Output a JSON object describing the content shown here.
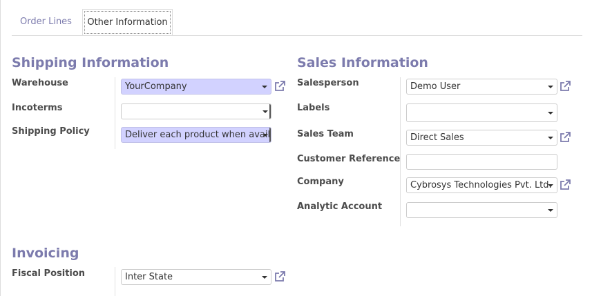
{
  "tabs": [
    {
      "label": "Order Lines",
      "active": false
    },
    {
      "label": "Other Information",
      "active": true
    }
  ],
  "shipping": {
    "title": "Shipping Information",
    "warehouse_label": "Warehouse",
    "warehouse_value": "YourCompany",
    "incoterms_label": "Incoterms",
    "incoterms_value": "",
    "policy_label": "Shipping Policy",
    "policy_value": "Deliver each product when availa"
  },
  "sales": {
    "title": "Sales Information",
    "salesperson_label": "Salesperson",
    "salesperson_value": "Demo User",
    "labels_label": "Labels",
    "labels_value": "",
    "team_label": "Sales Team",
    "team_value": "Direct Sales",
    "customer_ref_label": "Customer Reference",
    "customer_ref_value": "",
    "company_label": "Company",
    "company_value": "Cybrosys Technologies Pvt. Ltd.",
    "analytic_label": "Analytic Account",
    "analytic_value": ""
  },
  "invoicing": {
    "title": "Invoicing",
    "fiscal_label": "Fiscal Position",
    "fiscal_value": "Inter State"
  },
  "icons": {
    "external_link": "external-link-icon",
    "dropdown": "caret-down-icon"
  },
  "colors": {
    "accent": "#7c7bad",
    "required_bg": "#d2d2ff",
    "label": "#4c4c4c"
  }
}
